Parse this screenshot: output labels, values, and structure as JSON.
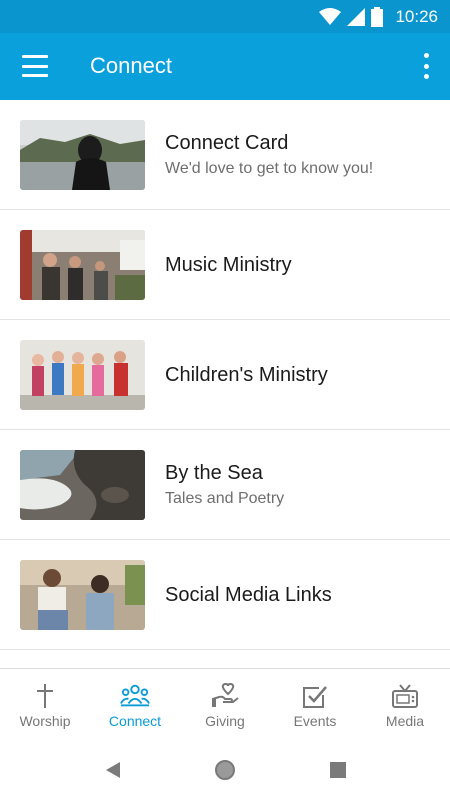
{
  "status_bar": {
    "time": "10:26",
    "icons": [
      "wifi-icon",
      "cell-signal-icon",
      "battery-icon"
    ]
  },
  "app_bar": {
    "title": "Connect",
    "menu_icon": "hamburger-menu-icon",
    "more_icon": "more-vert-icon"
  },
  "items": [
    {
      "title": "Connect Card",
      "subtitle": "We'd love to get to know you!"
    },
    {
      "title": "Music Ministry",
      "subtitle": ""
    },
    {
      "title": "Children's Ministry",
      "subtitle": ""
    },
    {
      "title": "By the Sea",
      "subtitle": "Tales and Poetry"
    },
    {
      "title": "Social Media Links",
      "subtitle": ""
    }
  ],
  "bottom_nav": [
    {
      "label": "Worship",
      "icon": "cross-icon",
      "active": false
    },
    {
      "label": "Connect",
      "icon": "people-group-icon",
      "active": true
    },
    {
      "label": "Giving",
      "icon": "hand-heart-icon",
      "active": false
    },
    {
      "label": "Events",
      "icon": "checkbox-icon",
      "active": false
    },
    {
      "label": "Media",
      "icon": "tv-icon",
      "active": false
    }
  ],
  "colors": {
    "status_bar": "#0a95cf",
    "app_bar": "#0aa0dc",
    "accent": "#0a9bd6",
    "inactive": "#777777"
  }
}
